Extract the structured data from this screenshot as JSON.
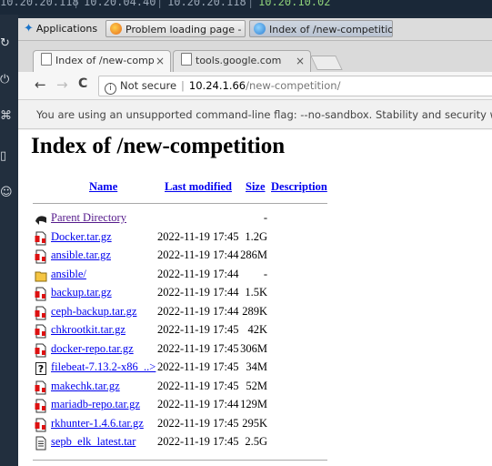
{
  "topbar": {
    "ip1": "10.20.20.118",
    "time": "10.20.04.40",
    "ip2": "10.20.20.118",
    "time2": "10.20.10.02"
  },
  "panel": {
    "applications": "Applications",
    "tasks": [
      {
        "label": "Problem loading page - ...",
        "active": false
      },
      {
        "label": "Index of /new-competitio...",
        "active": true
      }
    ]
  },
  "browser": {
    "tabs": [
      {
        "label": "Index of /new-comp",
        "active": true
      },
      {
        "label": "tools.google.com",
        "active": false
      }
    ],
    "nav": {
      "back": "←",
      "forward": "→",
      "reload": "C"
    },
    "address": {
      "security": "Not secure",
      "host": "10.24.1.66",
      "path": "/new-competition/"
    },
    "infobar": "You are using an unsupported command-line flag: --no-sandbox. Stability and security will"
  },
  "listing": {
    "title": "Index of /new-competition",
    "headers": {
      "name": "Name",
      "modified": "Last modified",
      "size": "Size",
      "description": "Description"
    },
    "rows": [
      {
        "icon": "back",
        "name": "Parent Directory",
        "date": "",
        "size": "-"
      },
      {
        "icon": "archive",
        "name": "Docker.tar.gz",
        "date": "2022-11-19 17:45",
        "size": "1.2G"
      },
      {
        "icon": "archive",
        "name": "ansible.tar.gz",
        "date": "2022-11-19 17:44",
        "size": "286M"
      },
      {
        "icon": "folder",
        "name": "ansible/",
        "date": "2022-11-19 17:44",
        "size": "-"
      },
      {
        "icon": "archive",
        "name": "backup.tar.gz",
        "date": "2022-11-19 17:44",
        "size": "1.5K"
      },
      {
        "icon": "archive",
        "name": "ceph-backup.tar.gz",
        "date": "2022-11-19 17:44",
        "size": "289K"
      },
      {
        "icon": "archive",
        "name": "chkrootkit.tar.gz",
        "date": "2022-11-19 17:45",
        "size": "42K"
      },
      {
        "icon": "archive",
        "name": "docker-repo.tar.gz",
        "date": "2022-11-19 17:45",
        "size": "306M"
      },
      {
        "icon": "unknown",
        "name": "filebeat-7.13.2-x86_..>",
        "date": "2022-11-19 17:45",
        "size": "34M"
      },
      {
        "icon": "archive",
        "name": "makechk.tar.gz",
        "date": "2022-11-19 17:45",
        "size": "52M"
      },
      {
        "icon": "archive",
        "name": "mariadb-repo.tar.gz",
        "date": "2022-11-19 17:44",
        "size": "129M"
      },
      {
        "icon": "archive",
        "name": "rkhunter-1.4.6.tar.gz",
        "date": "2022-11-19 17:45",
        "size": "295K"
      },
      {
        "icon": "text",
        "name": "sepb_elk_latest.tar",
        "date": "2022-11-19 17:45",
        "size": "2.5G"
      }
    ]
  },
  "colors": {
    "link": "#0000ee",
    "visited": "#551a8b",
    "desktop": "#1d2b3a"
  }
}
